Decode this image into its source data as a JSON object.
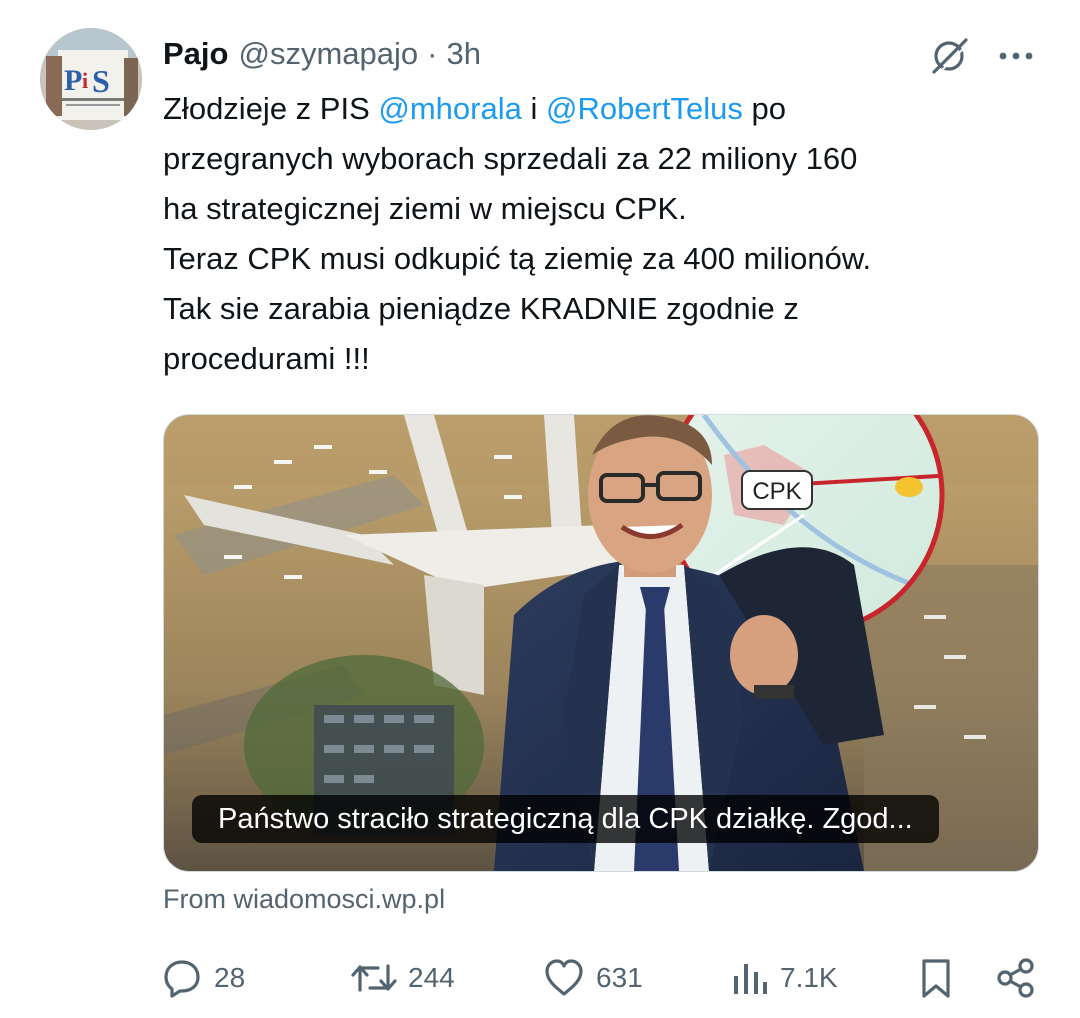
{
  "tweet": {
    "author_name": "Pajo",
    "author_handle": "@szymapajo",
    "separator": "·",
    "time": "3h",
    "text_line1_before": "Złodzieje z PIS ",
    "mention1": "@mhorala",
    "text_line1_mid": " i ",
    "mention2": "@RobertTelus",
    "text_line1_after": " po",
    "text_line2": "przegranych wyborach sprzedali za 22 miliony 160",
    "text_line3": "ha strategicznej ziemi w miejscu CPK.",
    "text_line4": "Teraz CPK musi odkupić tą ziemię za 400 milionów.",
    "text_line5": "Tak sie zarabia pieniądze KRADNIE zgodnie z",
    "text_line6": "procedurami !!!"
  },
  "card": {
    "caption": "Państwo straciło strategiczną dla CPK działkę. Zgod...",
    "map_label": "CPK",
    "source": "From wiadomosci.wp.pl"
  },
  "actions": {
    "replies": "28",
    "reposts": "244",
    "likes": "631",
    "views": "7.1K"
  },
  "icons": {
    "grok": "grok-icon",
    "more": "more-options-icon",
    "reply": "reply-icon",
    "repost": "repost-icon",
    "like": "like-icon",
    "views": "views-icon",
    "bookmark": "bookmark-icon",
    "share": "share-icon"
  },
  "colors": {
    "link": "#1d9bf0",
    "muted": "#536471",
    "text": "#0f1419",
    "border": "#cfd9de"
  }
}
